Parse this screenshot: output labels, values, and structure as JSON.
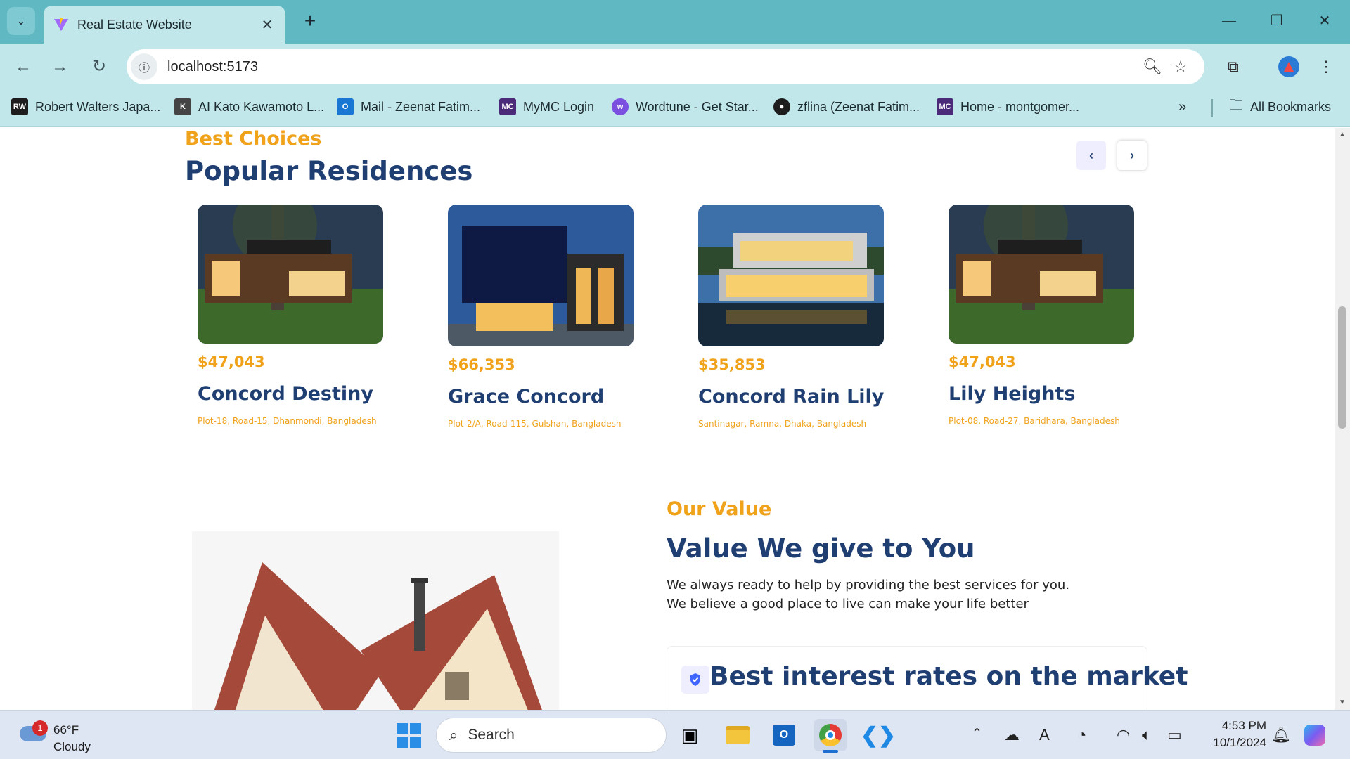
{
  "browser": {
    "tab_title": "Real Estate Website",
    "url": "localhost:5173",
    "bookmarks": [
      {
        "label": "Robert Walters Japa...",
        "icon_text": "RW",
        "color": "#1d1d1d"
      },
      {
        "label": "AI Kato Kawamoto L...",
        "icon_text": "K",
        "color": "#444444"
      },
      {
        "label": "Mail - Zeenat Fatim...",
        "icon_text": "O",
        "color": "#1976d2"
      },
      {
        "label": "MyMC Login",
        "icon_text": "MC",
        "color": "#4b2a7a"
      },
      {
        "label": "Wordtune - Get Star...",
        "icon_text": "w",
        "color": "#7b4fe0"
      },
      {
        "label": "zflina (Zeenat Fatim...",
        "icon_text": "●",
        "color": "#1d1d1d"
      },
      {
        "label": "Home - montgomer...",
        "icon_text": "MC",
        "color": "#4b2a7a"
      }
    ],
    "all_bookmarks": "All Bookmarks"
  },
  "residences": {
    "tag": "Best Choices",
    "title": "Popular Residences",
    "cards": [
      {
        "price": "$47,043",
        "name": "Concord Destiny",
        "address": "Plot-18, Road-15, Dhanmondi, Bangladesh"
      },
      {
        "price": "$66,353",
        "name": "Grace Concord",
        "address": "Plot-2/A, Road-115, Gulshan, Bangladesh"
      },
      {
        "price": "$35,853",
        "name": "Concord Rain Lily",
        "address": "Santinagar, Ramna, Dhaka, Bangladesh"
      },
      {
        "price": "$47,043",
        "name": "Lily Heights",
        "address": "Plot-08, Road-27, Baridhara, Bangladesh"
      }
    ]
  },
  "value": {
    "tag": "Our Value",
    "title": "Value We give to You",
    "desc_line1": "We always ready to help by providing the best services for you.",
    "desc_line2": "We believe a good place to live can make your life better",
    "accordion_title": "Best interest rates on the market"
  },
  "taskbar": {
    "weather_temp": "66°F",
    "weather_cond": "Cloudy",
    "weather_badge": "1",
    "search_placeholder": "Search",
    "time": "4:53 PM",
    "date": "10/1/2024"
  },
  "colors": {
    "accent": "#f0a21b",
    "navy": "#1f3e72",
    "chrome": "#5fb8c2"
  }
}
